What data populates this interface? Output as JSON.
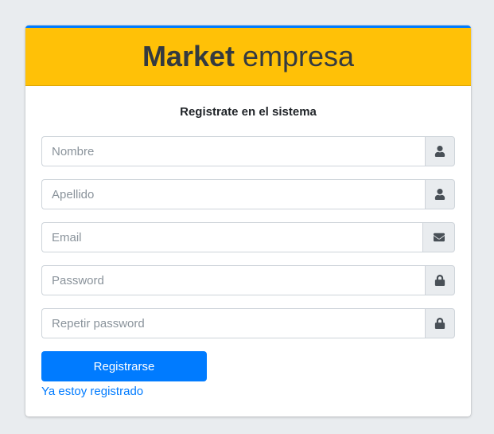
{
  "header": {
    "brand_bold": "Market",
    "brand_light": "empresa"
  },
  "form": {
    "message": "Registrate en el sistema",
    "fields": {
      "nombre": {
        "placeholder": "Nombre",
        "icon": "user-icon"
      },
      "apellido": {
        "placeholder": "Apellido",
        "icon": "user-icon"
      },
      "email": {
        "placeholder": "Email",
        "icon": "envelope-icon"
      },
      "password": {
        "placeholder": "Password",
        "icon": "lock-icon"
      },
      "repetir_password": {
        "placeholder": "Repetir password",
        "icon": "lock-icon"
      }
    },
    "submit_label": "Registrarse",
    "login_link": "Ya estoy registrado"
  },
  "colors": {
    "accent": "#007bff",
    "header_bg": "#ffc107",
    "page_bg": "#e9ecef"
  }
}
